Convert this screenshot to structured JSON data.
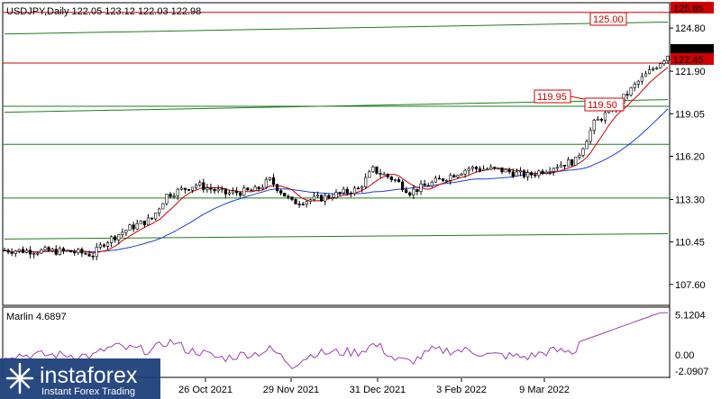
{
  "chart_data": {
    "type": "candlestick",
    "title": "USDJPY,Daily  122.05 123.12 122.03 122.98",
    "symbol": "USDJPY",
    "timeframe": "Daily",
    "last_bar": {
      "open": 122.05,
      "high": 123.12,
      "low": 122.03,
      "close": 122.98
    },
    "ylim": [
      106.2,
      126.5
    ],
    "y_ticks": [
      125.85,
      124.8,
      121.9,
      119.05,
      116.2,
      113.3,
      110.45,
      107.6
    ],
    "x_ticks": [
      "26 Oct 2021",
      "29 Nov 2021",
      "31 Dec 2021",
      "3 Feb 2022",
      "9 Mar 2022"
    ],
    "price_labels": {
      "current": "122.98",
      "red_level": "122.45",
      "top_level": "125.85"
    },
    "horizontal_lines": [
      {
        "value": 125.85,
        "color": "#d00000"
      },
      {
        "value": 122.45,
        "color": "#d00000"
      },
      {
        "value": 119.55,
        "color": "#1e7d1e"
      },
      {
        "value": 117.0,
        "color": "#1e7d1e"
      },
      {
        "value": 113.4,
        "color": "#1e7d1e"
      }
    ],
    "sloped_lines": [
      {
        "from": [
          0,
          124.4
        ],
        "to": [
          180,
          125.2
        ],
        "color": "#1e7d1e"
      },
      {
        "from": [
          0,
          119.15
        ],
        "to": [
          180,
          120.0
        ],
        "color": "#1e7d1e"
      },
      {
        "from": [
          0,
          110.65
        ],
        "to": [
          180,
          111.0
        ],
        "color": "#1e7d1e"
      }
    ],
    "annotations": [
      {
        "text": "125.00",
        "color": "#d00000"
      },
      {
        "text": "119.95",
        "color": "#d00000"
      },
      {
        "text": "119.50",
        "color": "#d00000"
      }
    ],
    "indicator": {
      "name": "Marlin",
      "value": "4.6897",
      "label": "Marlin 4.6897",
      "ylim": [
        -2.8,
        6.0
      ],
      "y_ticks": [
        "5.1204",
        "0.00",
        "-2.0907"
      ],
      "color": "#9b3fb0"
    },
    "series_colors": {
      "ma_fast": "#d00000",
      "ma_slow": "#1a3fd6",
      "candle": "#000000"
    }
  },
  "branding": {
    "logo_name": "instaforex",
    "tagline": "Instant Forex Trading"
  },
  "colors": {
    "background": "#ffffff",
    "text": "#000000",
    "logo_bg": "#1d3f7a"
  }
}
